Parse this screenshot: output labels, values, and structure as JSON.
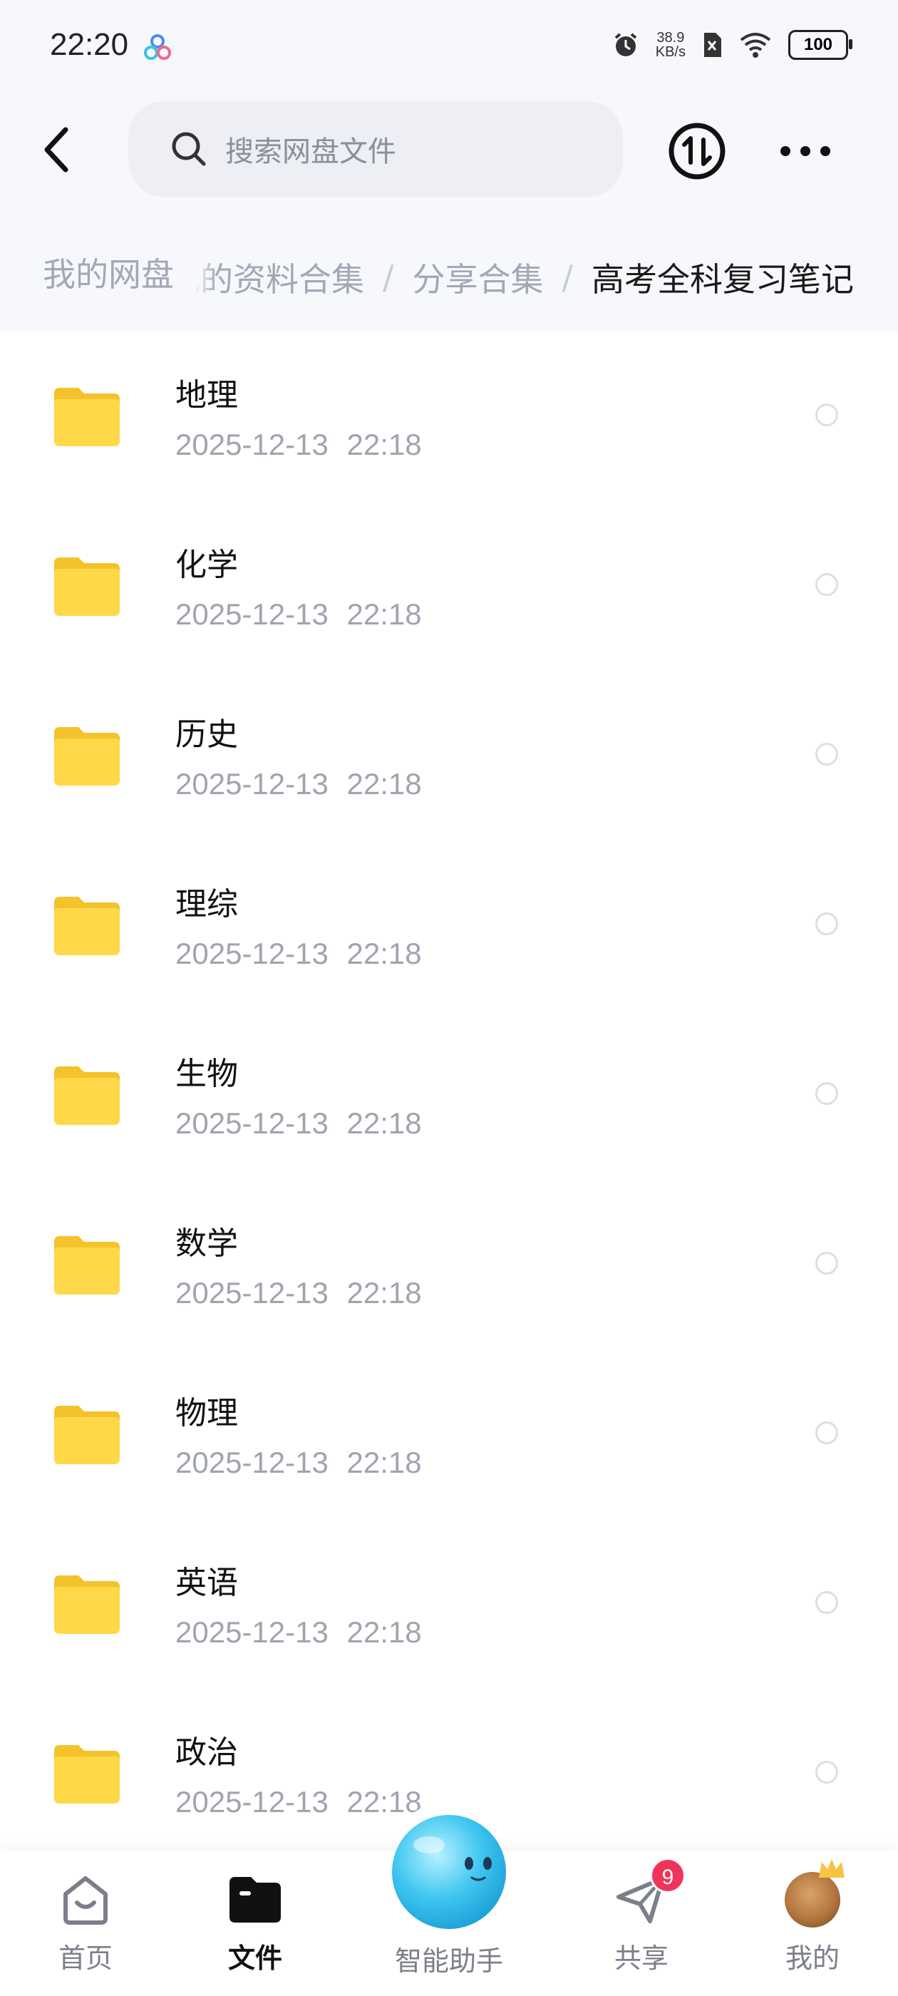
{
  "status_bar": {
    "time": "22:20",
    "speed_value": "38.9",
    "speed_unit": "KB/s",
    "battery": "100"
  },
  "header": {
    "search_placeholder": "搜索网盘文件"
  },
  "breadcrumb": {
    "root": "我的网盘",
    "items": [
      "我的资料合集",
      "分享合集",
      "高考全科复习笔记"
    ]
  },
  "files": [
    {
      "name": "地理",
      "date": "2025-12-13  22:18"
    },
    {
      "name": "化学",
      "date": "2025-12-13  22:18"
    },
    {
      "name": "历史",
      "date": "2025-12-13  22:18"
    },
    {
      "name": "理综",
      "date": "2025-12-13  22:18"
    },
    {
      "name": "生物",
      "date": "2025-12-13  22:18"
    },
    {
      "name": "数学",
      "date": "2025-12-13  22:18"
    },
    {
      "name": "物理",
      "date": "2025-12-13  22:18"
    },
    {
      "name": "英语",
      "date": "2025-12-13  22:18"
    },
    {
      "name": "政治",
      "date": "2025-12-13  22:18"
    }
  ],
  "nav": {
    "home": "首页",
    "files": "文件",
    "assistant": "智能助手",
    "share": "共享",
    "share_badge": "9",
    "me": "我的"
  },
  "colors": {
    "folder": "#ffd23c",
    "badge": "#f0335a",
    "assistant": "#3ec6f0"
  }
}
